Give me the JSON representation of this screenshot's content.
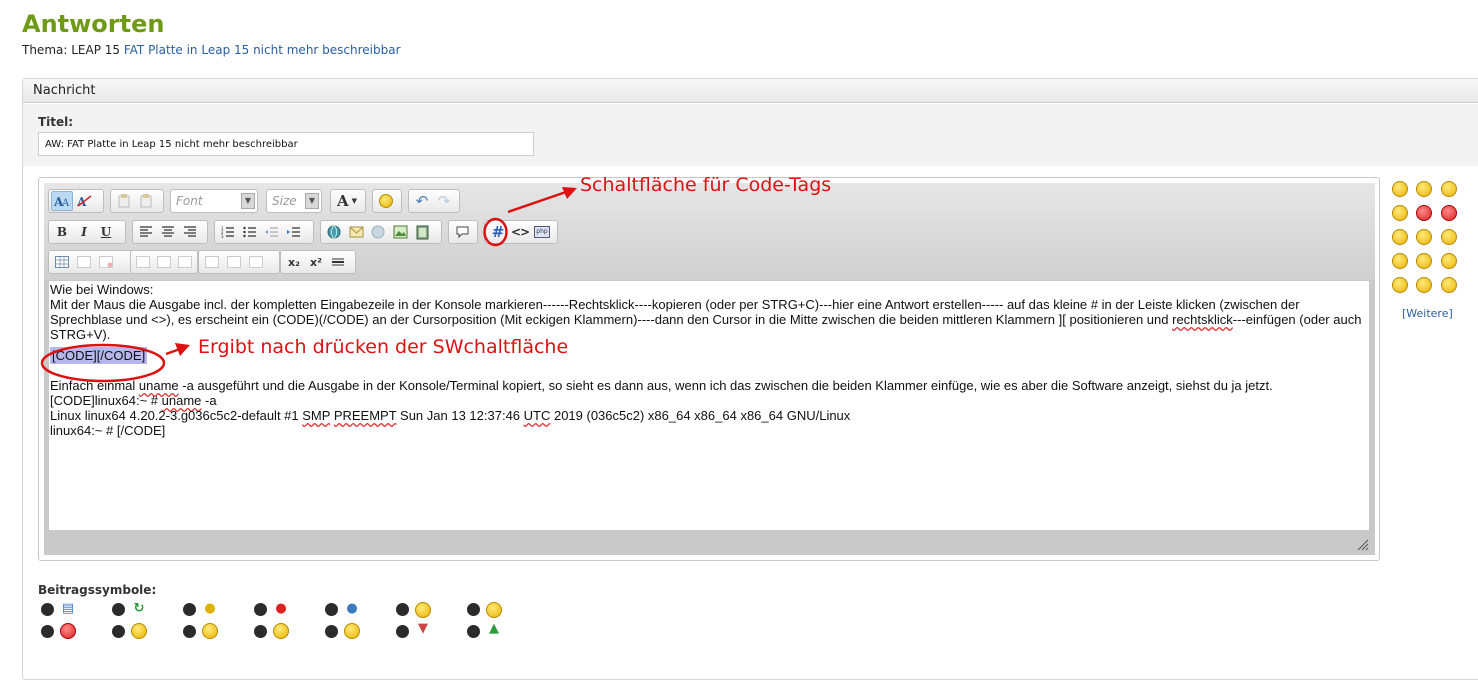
{
  "header": {
    "title": "Antworten",
    "thread_prefix": "Thema: LEAP 15 ",
    "thread_link": "FAT Platte in Leap 15 nicht mehr beschreibbar"
  },
  "panel": {
    "header": "Nachricht"
  },
  "title_field": {
    "label": "Titel:",
    "value": "AW: FAT Platte in Leap 15 nicht mehr beschreibbar"
  },
  "toolbar": {
    "font_placeholder": "Font",
    "size_placeholder": "Size",
    "font_color_label": "A",
    "bold": "B",
    "italic": "I",
    "underline": "U",
    "code_button": "#",
    "html_button": "<>",
    "php_button": "php",
    "subscript": "x₂",
    "superscript": "x²"
  },
  "editor": {
    "line1": "Wie bei Windows:",
    "line2_a": "Mit der Maus die Ausgabe incl. der kompletten Eingabezeile in der Konsole markieren------Rechtsklick----kopieren (oder per STRG+C)---hier eine Antwort erstellen----- auf das kleine # in der Leiste klicken (zwischen der Sprechblase und <>), es erscheint ein (CODE)(/CODE) an der Cursorposition (Mit eckigen Klammern)----dann den Cursor in die Mitte zwischen die beiden mittleren Klammern ][ positionieren und ",
    "line2_sq": "rechtsklick",
    "line2_b": "---einfügen (oder auch STRG+V).",
    "code_sample": "[CODE][/CODE]",
    "line3_a": "Einfach einmal ",
    "line3_sq": "uname",
    "line3_b": " -a ausgeführt und die Ausgabe in der Konsole/Terminal kopiert, so sieht es dann aus, wenn ich das zwischen die beiden Klammer einfüge, wie es aber die Software anzeigt, siehst du ja jetzt.",
    "line4_a": "[CODE]linux64:~ # ",
    "line4_sq": "uname",
    "line4_b": " -a",
    "line5_a": "Linux linux64 4.20.2-3.g036c5c2-default #1 ",
    "line5_sq1": "SMP",
    "line5_sp": " ",
    "line5_sq2": "PREEMPT",
    "line5_b": " Sun Jan 13 12:37:46 ",
    "line5_sq3": "UTC",
    "line5_c": " 2019 (036c5c2) x86_64 x86_64 x86_64 GNU/Linux",
    "line6": "linux64:~ # [/CODE]"
  },
  "annotations": {
    "code_tags": "Schaltfläche für Code-Tags",
    "result": "Ergibt nach drücken der SWchaltfläche"
  },
  "smilies": {
    "more_link": "[Weitere]"
  },
  "symbols": {
    "label": "Beitragssymbole:"
  },
  "colors": {
    "title_green": "#6f9a18",
    "link_blue": "#2a5f9e",
    "annotation_red": "#dd1111"
  }
}
